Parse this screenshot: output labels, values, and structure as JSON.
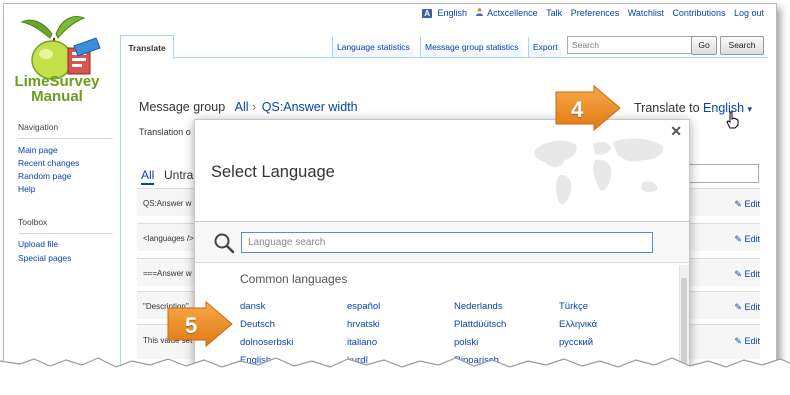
{
  "personal": {
    "language": "English",
    "user": "Actxcellence",
    "talk": "Talk",
    "preferences": "Preferences",
    "watchlist": "Watchlist",
    "contributions": "Contributions",
    "logout": "Log out"
  },
  "logo": {
    "title_line1": "LimeSurvey",
    "title_line2": "Manual"
  },
  "sidebar": {
    "navigation_heading": "Navigation",
    "navigation": [
      "Main page",
      "Recent changes",
      "Random page",
      "Help"
    ],
    "toolbox_heading": "Toolbox",
    "toolbox": [
      "Upload file",
      "Special pages"
    ]
  },
  "tabs": {
    "translate": "Translate",
    "language_statistics": "Language statistics",
    "message_group_statistics": "Message group statistics",
    "export": "Export"
  },
  "search": {
    "placeholder": "Search",
    "go": "Go",
    "search": "Search"
  },
  "main": {
    "message_group_label": "Message group",
    "group_all": "All",
    "group_sep": "›",
    "group_name": "QS:Answer width",
    "translate_to_label": "Translate to",
    "translate_to_lang": "English",
    "translation_label": "Translation o",
    "filter_all": "All",
    "filter_untranslated": "Untra",
    "rows": [
      {
        "text": "QS:Answer w",
        "edit": "Edit"
      },
      {
        "text": "<languages />",
        "edit": "Edit"
      },
      {
        "text": "===Answer w",
        "edit": "Edit"
      },
      {
        "text": "\"Description\"",
        "edit": "Edit"
      },
      {
        "text": "This value set",
        "edit": "Edit"
      }
    ]
  },
  "modal": {
    "title": "Select Language",
    "search_placeholder": "Language search",
    "common_title": "Common languages",
    "columns": [
      [
        "dansk",
        "Deutsch",
        "dolnoserbski",
        "English"
      ],
      [
        "español",
        "hrvatski",
        "italiano",
        "kurdî"
      ],
      [
        "Nederlands",
        "Plattdüütsch",
        "polski",
        "Ripoarisch"
      ],
      [
        "Türkçe",
        "Ελληνικά",
        "русский"
      ]
    ]
  },
  "callouts": {
    "four": "4",
    "five": "5"
  },
  "colors": {
    "link": "#0645ad",
    "callout_orange": "#f28c28",
    "border_blue": "#a7d7f9"
  }
}
